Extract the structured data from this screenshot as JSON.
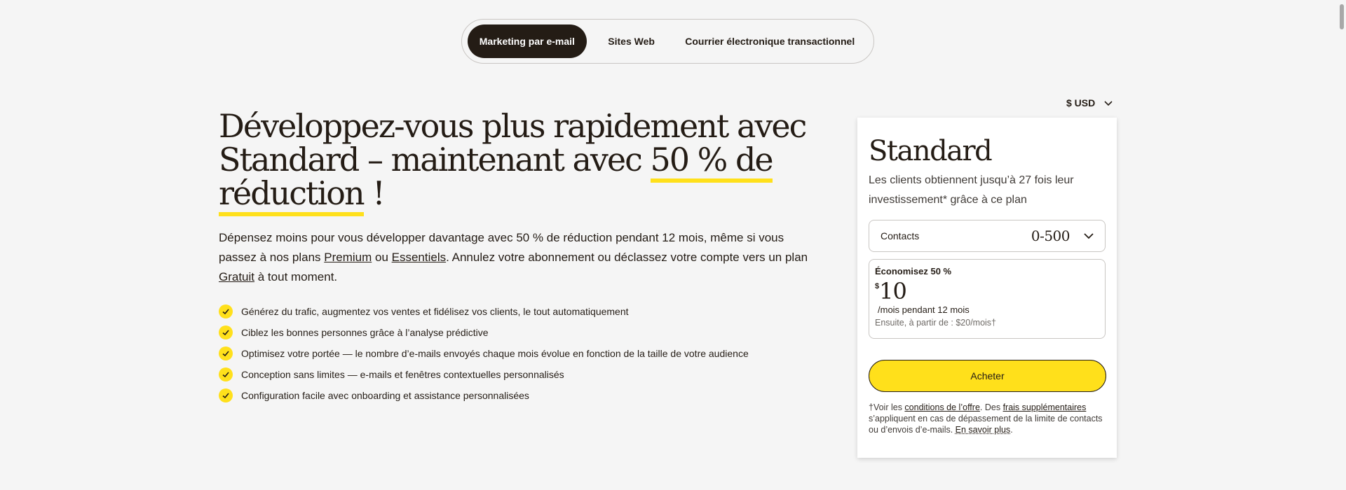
{
  "tabs": [
    {
      "label": "Marketing par e-mail",
      "active": true
    },
    {
      "label": "Sites Web",
      "active": false
    },
    {
      "label": "Courrier électronique transactionnel",
      "active": false
    }
  ],
  "currency": {
    "label": "$ USD",
    "icon": "chevron-down-icon"
  },
  "hero": {
    "headline_part1": "Développez-vous plus rapidement avec Standard – maintenant avec ",
    "headline_highlight1": "50 % de",
    "headline_highlight2": "réduction",
    "headline_end": " !",
    "lead_part1": "Dépensez moins pour vous développer davantage avec 50 % de réduction pendant 12 mois, même si vous passez à nos plans ",
    "link_premium": "Premium",
    "lead_part2": " ou ",
    "link_essentiels": "Essentiels",
    "lead_part3": ". Annulez votre abonnement ou déclassez votre compte vers un plan ",
    "link_gratuit": "Gratuit",
    "lead_part4": " à tout moment.",
    "features": [
      "Générez du trafic, augmentez vos ventes et fidélisez vos clients, le tout automatiquement",
      "Ciblez les bonnes personnes grâce à l’analyse prédictive",
      "Optimisez votre portée — le nombre d’e-mails envoyés chaque mois évolue en fonction de la taille de votre audience",
      "Conception sans limites — e-mails et fenêtres contextuelles personnalisés",
      "Configuration facile avec onboarding et assistance personnalisées"
    ]
  },
  "card": {
    "plan_name": "Standard",
    "description": "Les clients obtiennent jusqu’à 27 fois leur investissement* grâce à ce plan",
    "contacts_label": "Contacts",
    "contacts_value": "0-500",
    "savings": "Économisez 50 %",
    "price_currency": "$",
    "price_value": "10",
    "period": "/mois pendant 12 mois",
    "then": "Ensuite, à partir de : $20/mois†",
    "buy_label": "Acheter",
    "fine_part1": "†Voir les ",
    "fine_link1": "conditions de l’offre",
    "fine_part2": ". Des ",
    "fine_link2": "frais supplémentaires",
    "fine_part3": " s’appliquent en cas de dépassement de la limite de contacts ou d’envois d’e-mails. ",
    "fine_link3": "En savoir plus",
    "fine_part4": "."
  },
  "colors": {
    "accent": "#ffe01b",
    "dark": "#241c15",
    "background": "#f5f5f5"
  }
}
